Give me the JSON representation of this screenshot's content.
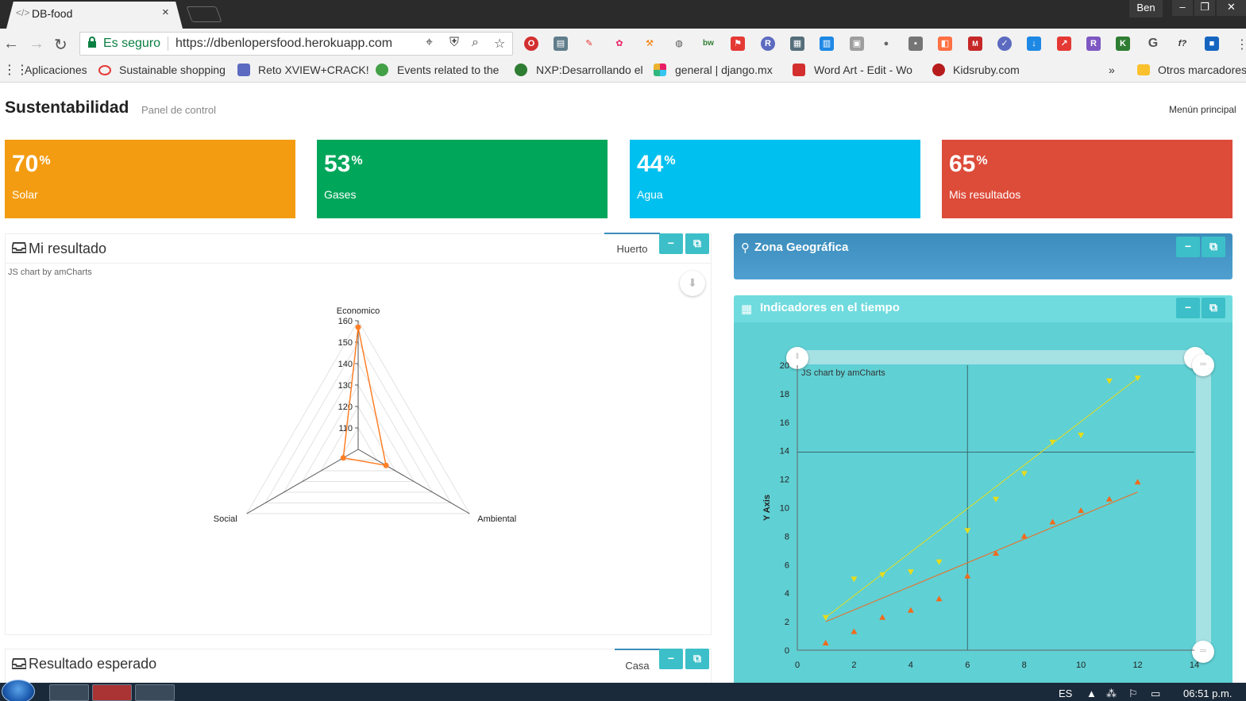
{
  "browser": {
    "tab_title": "DB-food",
    "tab_close": "×",
    "favicon": "</>",
    "user": "Ben",
    "secure_label": "Es seguro",
    "url": "https://dbenlopersfood.herokuapp.com",
    "bookmarks": [
      {
        "label": "Aplicaciones",
        "color": "#555"
      },
      {
        "label": "Sustainable shopping",
        "color": "#e53935"
      },
      {
        "label": "Reto XVIEW+CRACK!",
        "color": "#5c6bc0"
      },
      {
        "label": "Events related to the",
        "color": "#43a047"
      },
      {
        "label": "NXP:Desarrollando el",
        "color": "#2e7d32"
      },
      {
        "label": "general | django.mx",
        "color": "#e91e63"
      },
      {
        "label": "Word Art - Edit - Wo",
        "color": "#d32f2f"
      },
      {
        "label": "Kidsruby.com",
        "color": "#b71c1c"
      }
    ],
    "more_bookmarks": "»",
    "other_bookmarks": "Otros marcadores"
  },
  "header": {
    "title": "Sustentabilidad",
    "subtitle": "Panel de control",
    "menu_link": "Menún principal"
  },
  "stats": [
    {
      "value": "70",
      "unit": "%",
      "label": "Solar",
      "color": "#f39c12"
    },
    {
      "value": "53",
      "unit": "%",
      "label": "Gases",
      "color": "#00a65a"
    },
    {
      "value": "44",
      "unit": "%",
      "label": "Agua",
      "color": "#00c0ef"
    },
    {
      "value": "65",
      "unit": "%",
      "label": "Mis resultados",
      "color": "#dd4b39"
    }
  ],
  "mi_resultado": {
    "title": "Mi resultado",
    "tab": "Huerto",
    "credit": "JS chart by amCharts"
  },
  "resultado_esperado": {
    "title": "Resultado esperado",
    "tab": "Casa"
  },
  "zona": {
    "title": "Zona Geográfica"
  },
  "indicadores": {
    "title": "Indicadores en el tiempo",
    "credit": "JS chart by amCharts"
  },
  "radar_chart": {
    "type": "radar",
    "axes": [
      "Economico",
      "Ambiental",
      "Social"
    ],
    "ticks": [
      110,
      120,
      130,
      140,
      150,
      160
    ],
    "range": [
      100,
      160
    ],
    "values": [
      157,
      115,
      108
    ],
    "color": "#ff7f27"
  },
  "chart_data": {
    "type": "scatter",
    "xlabel": "",
    "ylabel": "Y Axis",
    "xlim": [
      0,
      14
    ],
    "ylim": [
      0,
      20
    ],
    "xticks": [
      0,
      2,
      4,
      6,
      8,
      10,
      12,
      14
    ],
    "yticks": [
      0,
      2,
      4,
      6,
      8,
      10,
      12,
      14,
      16,
      18,
      20
    ],
    "series": [
      {
        "marker": "triangle-down",
        "color": "#e8dc1a",
        "points": [
          [
            1,
            2.3
          ],
          [
            2,
            5
          ],
          [
            3,
            5.3
          ],
          [
            4,
            5.5
          ],
          [
            5,
            6.2
          ],
          [
            6,
            8.4
          ],
          [
            7,
            10.6
          ],
          [
            8,
            12.4
          ],
          [
            9,
            14.6
          ],
          [
            10,
            15.1
          ],
          [
            11,
            18.9
          ],
          [
            12,
            19.1
          ]
        ],
        "trend": [
          [
            1,
            2.3
          ],
          [
            12,
            19.1
          ]
        ]
      },
      {
        "marker": "triangle-up",
        "color": "#f26a1b",
        "points": [
          [
            1,
            0.5
          ],
          [
            2,
            1.3
          ],
          [
            3,
            2.3
          ],
          [
            4,
            2.8
          ],
          [
            5,
            3.6
          ],
          [
            6,
            5.2
          ],
          [
            7,
            6.8
          ],
          [
            8,
            8
          ],
          [
            9,
            9
          ],
          [
            10,
            9.8
          ],
          [
            11,
            10.6
          ],
          [
            12,
            11.8
          ]
        ],
        "trend": [
          [
            1,
            2
          ],
          [
            12,
            11.1
          ]
        ]
      }
    ]
  },
  "taskbar": {
    "lang": "ES",
    "time": "06:51 p.m."
  }
}
